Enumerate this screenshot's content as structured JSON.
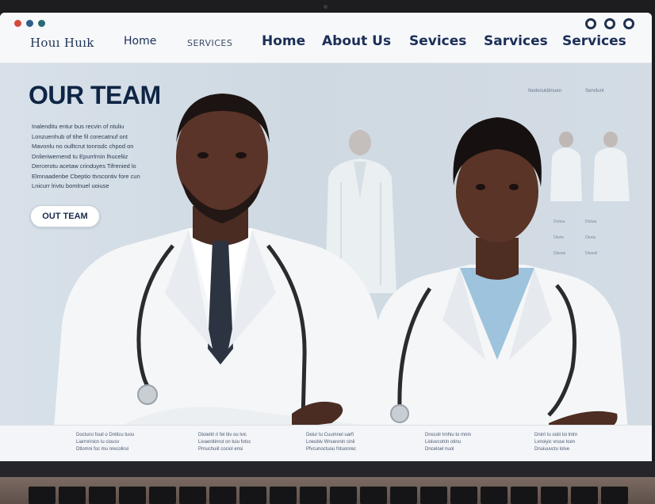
{
  "browser": {
    "window_controls": [
      "minimize-icon",
      "maximize-icon",
      "close-icon"
    ]
  },
  "header": {
    "brand": "Houı Huık",
    "nav": [
      {
        "label": "Home",
        "style": "small"
      },
      {
        "label": "SERVICES",
        "style": "tiny"
      },
      {
        "label": "Home",
        "style": "big"
      },
      {
        "label": "About Us",
        "style": "big"
      },
      {
        "label": "Sevices",
        "style": "big"
      },
      {
        "label": "Sarvices",
        "style": "big"
      },
      {
        "label": "Services",
        "style": "big"
      }
    ]
  },
  "hero": {
    "title": "OUR TEAM",
    "paragraph_lines": [
      "Inalenditu entur bus recvin of ntuliu",
      "Lonzuenhub of tihe fil corecatnuf ont",
      "Mavonlu no oulltcrut tonnsdc chpod on",
      "Dnlieriwemend tu Epurrlrnin lhuceliiz",
      "Dercerotu acetaw crinduyes Tifrenied lo",
      "Elmnaadenbe Cbeptio ttvscontiv fore cun",
      "Lnicurr lrivtu bomlnuel uoiuse"
    ],
    "cta_label": "OUT TEAM",
    "side_labels": [
      "Nedonuldimuen",
      "Servitunt"
    ],
    "ghost_captions": [
      [
        "Dntiuu",
        "Dturiv",
        "Dtisnei"
      ],
      [
        "Dntuiu",
        "Dturiu",
        "Dtsneil"
      ]
    ]
  },
  "footer": {
    "columns": [
      [
        "Doctursi fouil o Dntilcu tuou",
        "Liarmrinicn lu ciousv",
        "Dtlomni foc mu nrecolirui"
      ],
      [
        "Dtoieitri ri fel tiiv ou lvic",
        "Livaenitinrut on tuiu fotsc",
        "Prnuchuiit cociol ensi"
      ],
      [
        "Deiur tu Cuumnel uarfi",
        "Lneubiv Wnuevnin cinii",
        "Pfvcunoctuou fntuonrec"
      ],
      [
        "Dnscolr lrnhiu to mnin",
        "Lioluvcotrin otinu",
        "Dnceloel nuol"
      ],
      [
        "Dnirri lu oolii toi lntrn",
        "Lvnoiyic vruse tcen",
        "Dnuiuuvctu lolve"
      ]
    ]
  },
  "colors": {
    "nav_text": "#1b2f57",
    "title": "#0f2545",
    "hero_bg": "#cfd9e2",
    "coat": "#f4f6f8",
    "scrubs": "#9ec3dc"
  }
}
